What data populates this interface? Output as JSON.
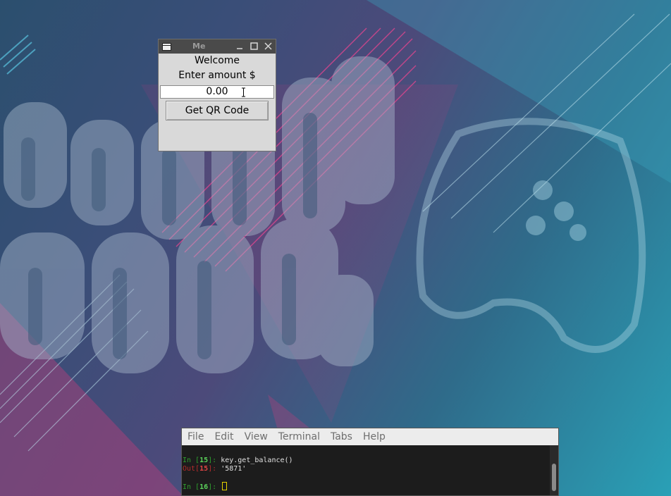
{
  "tk_window": {
    "title": "Me",
    "title_icon": "window-app-icon",
    "buttons": [
      "minimize-icon",
      "maximize-icon",
      "close-icon"
    ],
    "welcome": "Welcome",
    "amount_label": "Enter amount $",
    "amount_value": "0.00",
    "qr_button": "Get QR Code"
  },
  "terminal": {
    "menu": [
      "File",
      "Edit",
      "View",
      "Terminal",
      "Tabs",
      "Help"
    ],
    "lines": [
      {
        "prefix": "In [",
        "num": "15",
        "suffix": "]: ",
        "text": "key.get_balance()"
      },
      {
        "prefix": "Out[",
        "num": "15",
        "suffix": "]: ",
        "text": "'5871'"
      },
      {
        "prefix": "",
        "num": "",
        "suffix": "",
        "text": ""
      },
      {
        "prefix": "In [",
        "num": "16",
        "suffix": "]: ",
        "text": ""
      }
    ]
  },
  "colors": {
    "accent_pink": "#d63d8c",
    "terminal_bg": "#1c1c1c",
    "prompt_in": "#2e9e2e",
    "prompt_out": "#b52b2b"
  }
}
